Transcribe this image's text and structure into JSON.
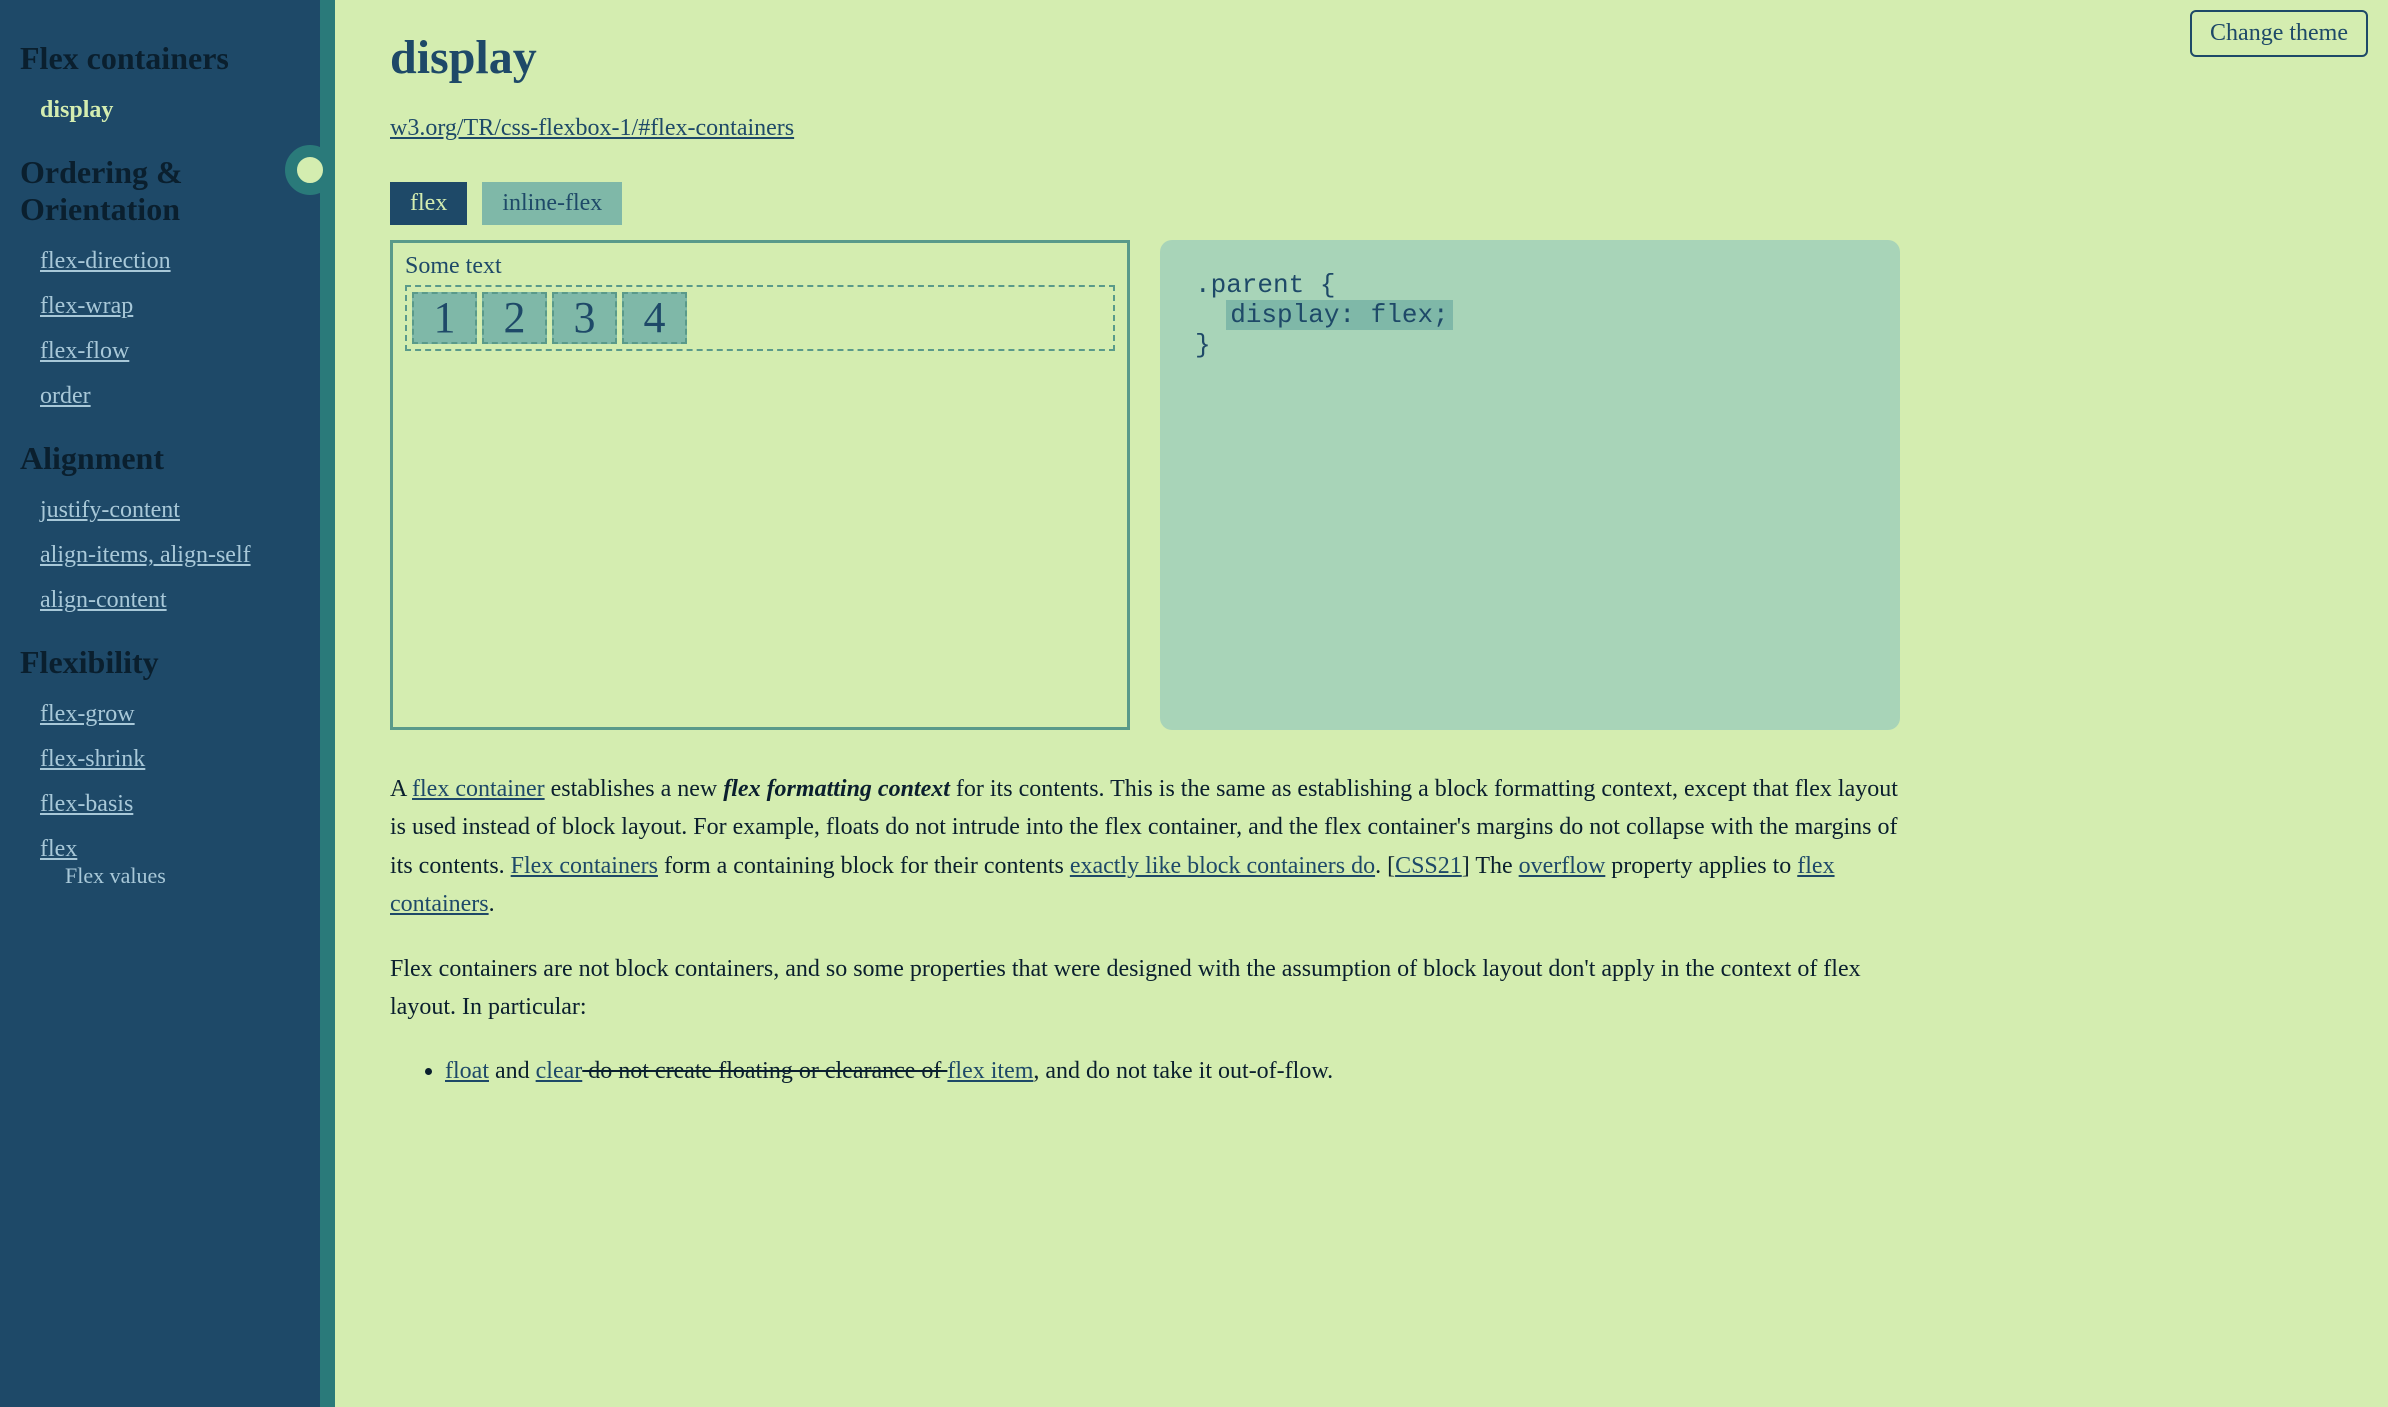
{
  "theme_button": "Change theme",
  "sidebar": {
    "sections": [
      {
        "title": "Flex containers",
        "items": [
          {
            "label": "display",
            "active": true
          }
        ]
      },
      {
        "title": "Ordering & Orientation",
        "items": [
          {
            "label": "flex-direction"
          },
          {
            "label": "flex-wrap"
          },
          {
            "label": "flex-flow"
          },
          {
            "label": "order"
          }
        ]
      },
      {
        "title": "Alignment",
        "items": [
          {
            "label": "justify-content"
          },
          {
            "label": "align-items, align-self"
          },
          {
            "label": "align-content"
          }
        ]
      },
      {
        "title": "Flexibility",
        "items": [
          {
            "label": "flex-grow"
          },
          {
            "label": "flex-shrink"
          },
          {
            "label": "flex-basis"
          },
          {
            "label": "flex",
            "sub": [
              {
                "label": "Flex values"
              }
            ]
          }
        ]
      }
    ]
  },
  "main": {
    "title": "display",
    "spec_link": "w3.org/TR/css-flexbox-1/#flex-containers",
    "tabs": [
      {
        "label": "flex",
        "active": true
      },
      {
        "label": "inline-flex",
        "active": false
      }
    ],
    "demo": {
      "label": "Some text",
      "items": [
        "1",
        "2",
        "3",
        "4"
      ]
    },
    "code": {
      "line1": ".parent {",
      "line2": "display: flex;",
      "line3": "}"
    },
    "description": {
      "p1_prefix": "A ",
      "p1_link1": "flex container",
      "p1_mid1": " establishes a new ",
      "p1_em": "flex formatting context",
      "p1_mid2": " for its contents. This is the same as establishing a block formatting context, except that flex layout is used instead of block layout. For example, floats do not intrude into the flex container, and the flex container's margins do not collapse with the margins of its contents. ",
      "p1_link2": "Flex containers",
      "p1_mid3": " form a containing block for their contents ",
      "p1_link3": "exactly like block containers do",
      "p1_mid4": ". [",
      "p1_link4": "CSS21",
      "p1_mid5": "] The ",
      "p1_link5": "overflow",
      "p1_mid6": " property applies to ",
      "p1_link6": "flex containers",
      "p1_end": ".",
      "p2": "Flex containers are not block containers, and so some properties that were designed with the assumption of block layout don't apply in the context of flex layout. In particular:",
      "li1_link1": "float",
      "li1_mid1": " and ",
      "li1_link2": "clear",
      "li1_strike": " do not create floating or clearance of ",
      "li1_link3": "flex item",
      "li1_end": ", and do not take it out-of-flow."
    }
  }
}
